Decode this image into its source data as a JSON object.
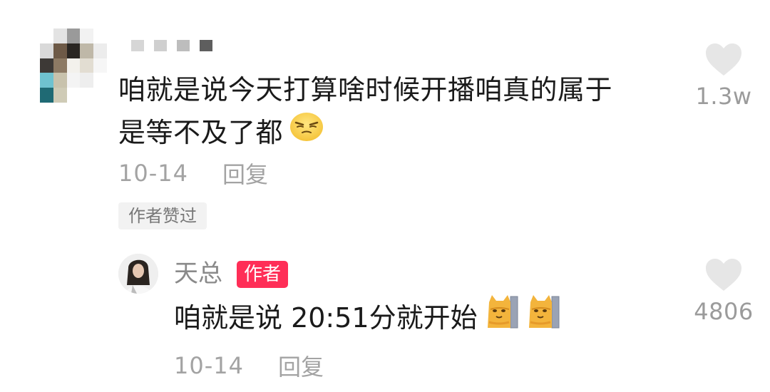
{
  "comment": {
    "text_line1": "咱就是说今天打算啥时候开播咱真的属于",
    "text_line2": "是等不及了都",
    "emoji": "smirk-emoji",
    "date": "10-14",
    "reply_label": "回复",
    "liked_by_author_label": "作者赞过",
    "like_count": "1.3w"
  },
  "reply": {
    "username": "天总",
    "author_tag": "作者",
    "text": "咱就是说 20:51分就开始",
    "emojis": [
      "cat-emoji",
      "cat-emoji"
    ],
    "date": "10-14",
    "reply_label": "回复",
    "like_count": "4806"
  },
  "colors": {
    "author_tag_bg": "#ff2e57",
    "meta_text": "#a3a3a3",
    "heart": "#e6e6e6"
  }
}
